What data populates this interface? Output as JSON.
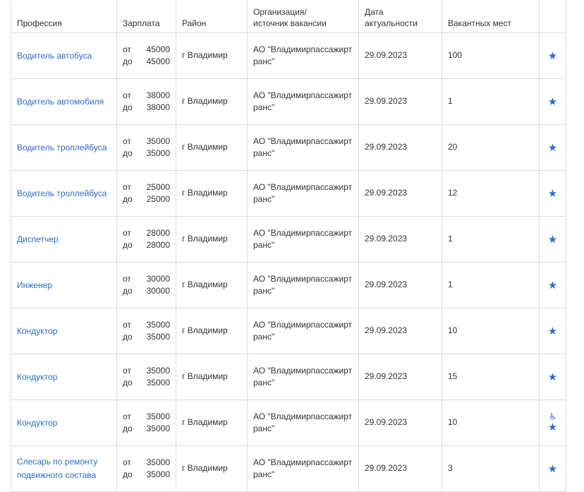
{
  "headers": {
    "profession": "Профессия",
    "salary": "Зарплата",
    "district": "Район",
    "organization_line1": "Организация/",
    "organization_line2": "источник вакансии",
    "date_line1": "Дата",
    "date_line2": "актуальности",
    "vacancies": "Вакантных мест"
  },
  "labels": {
    "from": "от",
    "to": "до"
  },
  "colors": {
    "link": "#2b6dc9",
    "border": "#dddddd",
    "text": "#333333"
  },
  "icons": {
    "favorite": "star-icon",
    "accessibility": "wheelchair-icon"
  },
  "rows": [
    {
      "profession": "Водитель автобуса",
      "salary_from": "45000",
      "salary_to": "45000",
      "district": "г Владимир",
      "org": "АО \"Владимирпассажиртранс\"",
      "date": "29.09.2023",
      "vacancies": "100",
      "accessible": false
    },
    {
      "profession": "Водитель автомобиля",
      "salary_from": "38000",
      "salary_to": "38000",
      "district": "г Владимир",
      "org": "АО \"Владимирпассажиртранс\"",
      "date": "29.09.2023",
      "vacancies": "1",
      "accessible": false
    },
    {
      "profession": "Водитель троллейбуса",
      "salary_from": "35000",
      "salary_to": "35000",
      "district": "г Владимир",
      "org": "АО \"Владимирпассажиртранс\"",
      "date": "29.09.2023",
      "vacancies": "20",
      "accessible": false
    },
    {
      "profession": "Водитель троллейбуса",
      "salary_from": "25000",
      "salary_to": "25000",
      "district": "г Владимир",
      "org": "АО \"Владимирпассажиртранс\"",
      "date": "29.09.2023",
      "vacancies": "12",
      "accessible": false
    },
    {
      "profession": "Диспетчер",
      "salary_from": "28000",
      "salary_to": "28000",
      "district": "г Владимир",
      "org": "АО \"Владимирпассажиртранс\"",
      "date": "29.09.2023",
      "vacancies": "1",
      "accessible": false
    },
    {
      "profession": "Инженер",
      "salary_from": "30000",
      "salary_to": "30000",
      "district": "г Владимир",
      "org": "АО \"Владимирпассажиртранс\"",
      "date": "29.09.2023",
      "vacancies": "1",
      "accessible": false
    },
    {
      "profession": "Кондуктор",
      "salary_from": "35000",
      "salary_to": "35000",
      "district": "г Владимир",
      "org": "АО \"Владимирпассажиртранс\"",
      "date": "29.09.2023",
      "vacancies": "10",
      "accessible": false
    },
    {
      "profession": "Кондуктор",
      "salary_from": "35000",
      "salary_to": "35000",
      "district": "г Владимир",
      "org": "АО \"Владимирпассажиртранс\"",
      "date": "29.09.2023",
      "vacancies": "15",
      "accessible": false
    },
    {
      "profession": "Кондуктор",
      "salary_from": "35000",
      "salary_to": "35000",
      "district": "г Владимир",
      "org": "АО \"Владимирпассажиртранс\"",
      "date": "29.09.2023",
      "vacancies": "10",
      "accessible": true
    },
    {
      "profession": "Слесарь по ремонту подвижного состава",
      "salary_from": "35000",
      "salary_to": "35000",
      "district": "г Владимир",
      "org": "АО \"Владимирпассажиртранс\"",
      "date": "29.09.2023",
      "vacancies": "3",
      "accessible": false
    }
  ]
}
